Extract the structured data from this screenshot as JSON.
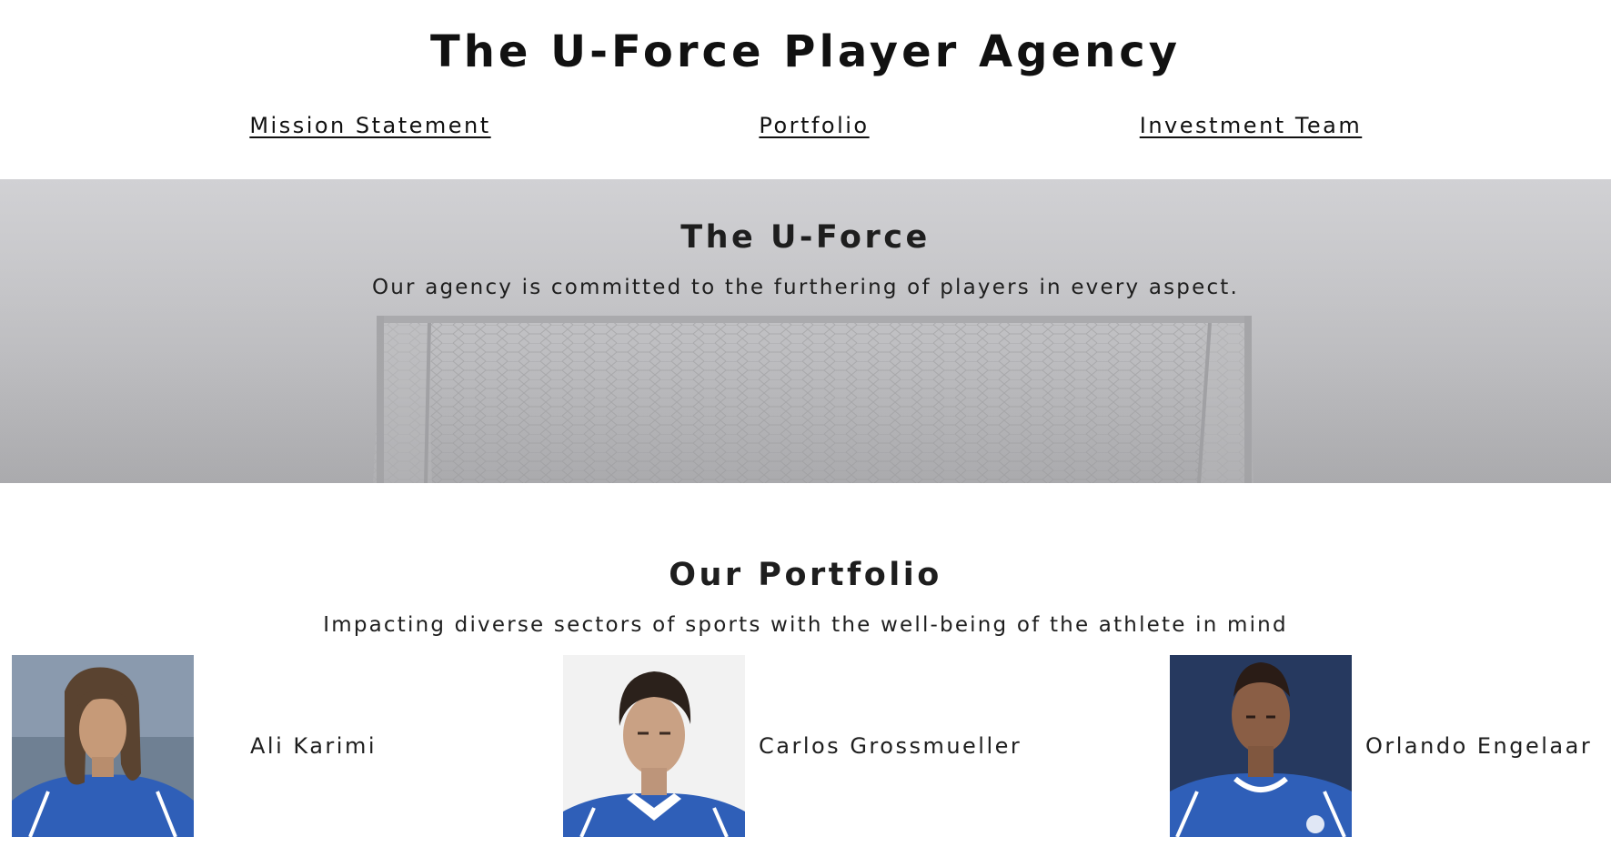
{
  "header": {
    "title": "The U-Force Player Agency",
    "nav": [
      {
        "label": "Mission Statement"
      },
      {
        "label": "Portfolio"
      },
      {
        "label": "Investment Team"
      }
    ]
  },
  "hero": {
    "title": "The U-Force",
    "subtitle": "Our agency is committed to the furthering of players in every aspect.",
    "image": "soccer-goal-in-fog"
  },
  "portfolio": {
    "title": "Our Portfolio",
    "subtitle": "Impacting diverse sectors of sports with the well-being of the athlete in mind",
    "players": [
      {
        "name": "Ali Karimi"
      },
      {
        "name": "Carlos Grossmueller"
      },
      {
        "name": "Orlando Engelaar"
      }
    ]
  },
  "colors": {
    "text": "#111111",
    "kit_blue": "#2f5fb8",
    "hero_gray": "#c6c6c9"
  }
}
